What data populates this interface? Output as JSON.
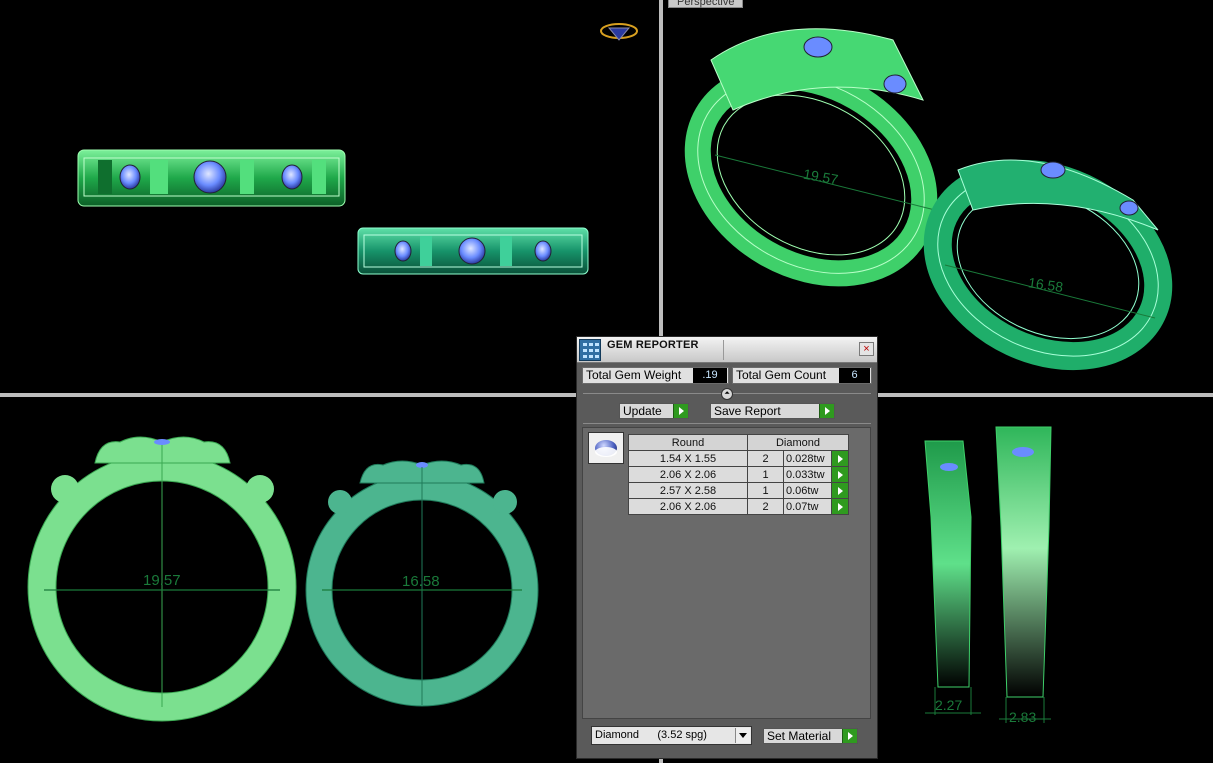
{
  "viewport_label": "Perspective",
  "dimensions": {
    "ring_large": "19.57",
    "ring_small": "16.58",
    "side_large": "2.27",
    "side_small": "2.83"
  },
  "dialog": {
    "title": "GEM REPORTER",
    "close_glyph": "×",
    "total_weight_label": "Total Gem Weight",
    "total_weight_value": ".19",
    "total_count_label": "Total Gem Count",
    "total_count_value": "6",
    "collapse_glyph": "⏶",
    "update_label": "Update",
    "save_report_label": "Save Report",
    "table": {
      "header_shape": "Round",
      "header_material": "Diamond",
      "rows": [
        {
          "size": "1.54 X 1.55",
          "count": "2",
          "weight": "0.028tw"
        },
        {
          "size": "2.06 X 2.06",
          "count": "1",
          "weight": "0.033tw"
        },
        {
          "size": "2.57 X 2.58",
          "count": "1",
          "weight": "0.06tw"
        },
        {
          "size": "2.06 X 2.06",
          "count": "2",
          "weight": "0.07tw"
        }
      ]
    },
    "material_select_value": "Diamond      (3.52 spg)",
    "set_material_label": "Set Material"
  },
  "colors": {
    "ring_green": "#3fd06a",
    "ring_teal": "#1fae6a",
    "gem_blue": "#6a8cff",
    "dimension_line": "#1a7a3a"
  }
}
